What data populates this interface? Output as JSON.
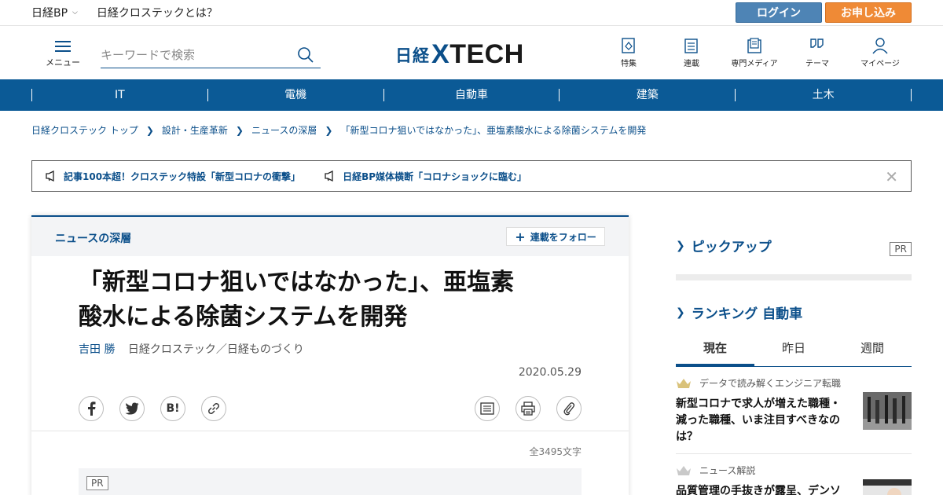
{
  "topbar": {
    "nikkei_bp": "日経BP",
    "about": "日経クロステックとは？",
    "login": "ログイン",
    "apply": "お申し込み"
  },
  "header": {
    "menu_label": "メニュー",
    "search_placeholder": "キーワードで検索",
    "logo_nikkei": "日経",
    "logo_x": "X",
    "logo_tech": "TECH",
    "nav": [
      {
        "label": "特集",
        "icon": "feature-icon"
      },
      {
        "label": "連載",
        "icon": "series-icon"
      },
      {
        "label": "専門メディア",
        "icon": "media-icon"
      },
      {
        "label": "テーマ",
        "icon": "theme-icon"
      },
      {
        "label": "マイページ",
        "icon": "user-icon"
      }
    ]
  },
  "categories": [
    "IT",
    "電機",
    "自動車",
    "建築",
    "土木"
  ],
  "breadcrumb": [
    "日経クロステック トップ",
    "設計・生産革新",
    "ニュースの深層",
    "「新型コロナ狙いではなかった」、亜塩素酸水による除菌システムを開発"
  ],
  "announce": [
    "記事100本超！クロステック特設「新型コロナの衝撃」",
    "日経BP媒体横断「コロナショックに臨む」"
  ],
  "article": {
    "series": "ニュースの深層",
    "follow": "連載をフォロー",
    "title_line1": "「新型コロナ狙いではなかった」、亜塩素",
    "title_line2": "酸水による除菌システムを開発",
    "author": "吉田 勝",
    "media": "日経クロステック／日経ものづくり",
    "date": "2020.05.29",
    "share": {
      "hatena": "B!"
    },
    "char_count": "全3495文字",
    "ad_tag": "PR"
  },
  "sidebar": {
    "pickup_title": "ピックアップ",
    "pr_tag": "PR",
    "ranking_title": "ランキング 自動車",
    "tabs": [
      "現在",
      "昨日",
      "週間"
    ],
    "items": [
      {
        "category": "データで読み解くエンジニア転職",
        "text": "新型コロナで求人が増えた職種・減った職種、いま注目すべきなのは？"
      },
      {
        "category": "ニュース解説",
        "text": "品質管理の手抜きが露呈、デンソ"
      }
    ]
  },
  "colors": {
    "brand": "#0b4f8a",
    "nav_bg": "#0b5a96",
    "login": "#4e84b5",
    "apply": "#ef8a36",
    "crown": "#d9c27a"
  }
}
